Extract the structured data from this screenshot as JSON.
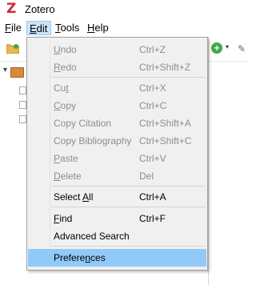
{
  "window": {
    "title": "Zotero",
    "logo_text": "Z"
  },
  "menubar": [
    {
      "label": "File",
      "mnemonic_index": 0
    },
    {
      "label": "Edit",
      "mnemonic_index": 0
    },
    {
      "label": "Tools",
      "mnemonic_index": 0
    },
    {
      "label": "Help",
      "mnemonic_index": 0
    }
  ],
  "toolbar": {
    "new_item_icon": "plus-icon",
    "caret": "▾",
    "edit_icon": "pen-icon"
  },
  "edit_menu": {
    "items": [
      {
        "label": "Undo",
        "shortcut": "Ctrl+Z",
        "disabled": true,
        "mnemonic_index": 0
      },
      {
        "label": "Redo",
        "shortcut": "Ctrl+Shift+Z",
        "disabled": true,
        "mnemonic_index": 0
      },
      {
        "label": "Cut",
        "shortcut": "Ctrl+X",
        "disabled": true,
        "mnemonic_index": 2
      },
      {
        "label": "Copy",
        "shortcut": "Ctrl+C",
        "disabled": true,
        "mnemonic_index": 0
      },
      {
        "label": "Copy Citation",
        "shortcut": "Ctrl+Shift+A",
        "disabled": true
      },
      {
        "label": "Copy Bibliography",
        "shortcut": "Ctrl+Shift+C",
        "disabled": true
      },
      {
        "label": "Paste",
        "shortcut": "Ctrl+V",
        "disabled": true,
        "mnemonic_index": 0
      },
      {
        "label": "Delete",
        "shortcut": "Del",
        "disabled": true,
        "mnemonic_index": 0
      },
      {
        "label": "Select All",
        "shortcut": "Ctrl+A",
        "disabled": false,
        "mnemonic_index": 7
      },
      {
        "label": "Find",
        "shortcut": "Ctrl+F",
        "disabled": false,
        "mnemonic_index": 0
      },
      {
        "label": "Advanced Search",
        "shortcut": "",
        "disabled": false
      },
      {
        "label": "Preferences",
        "shortcut": "",
        "disabled": false,
        "highlighted": true,
        "mnemonic_index": 7
      }
    ]
  }
}
